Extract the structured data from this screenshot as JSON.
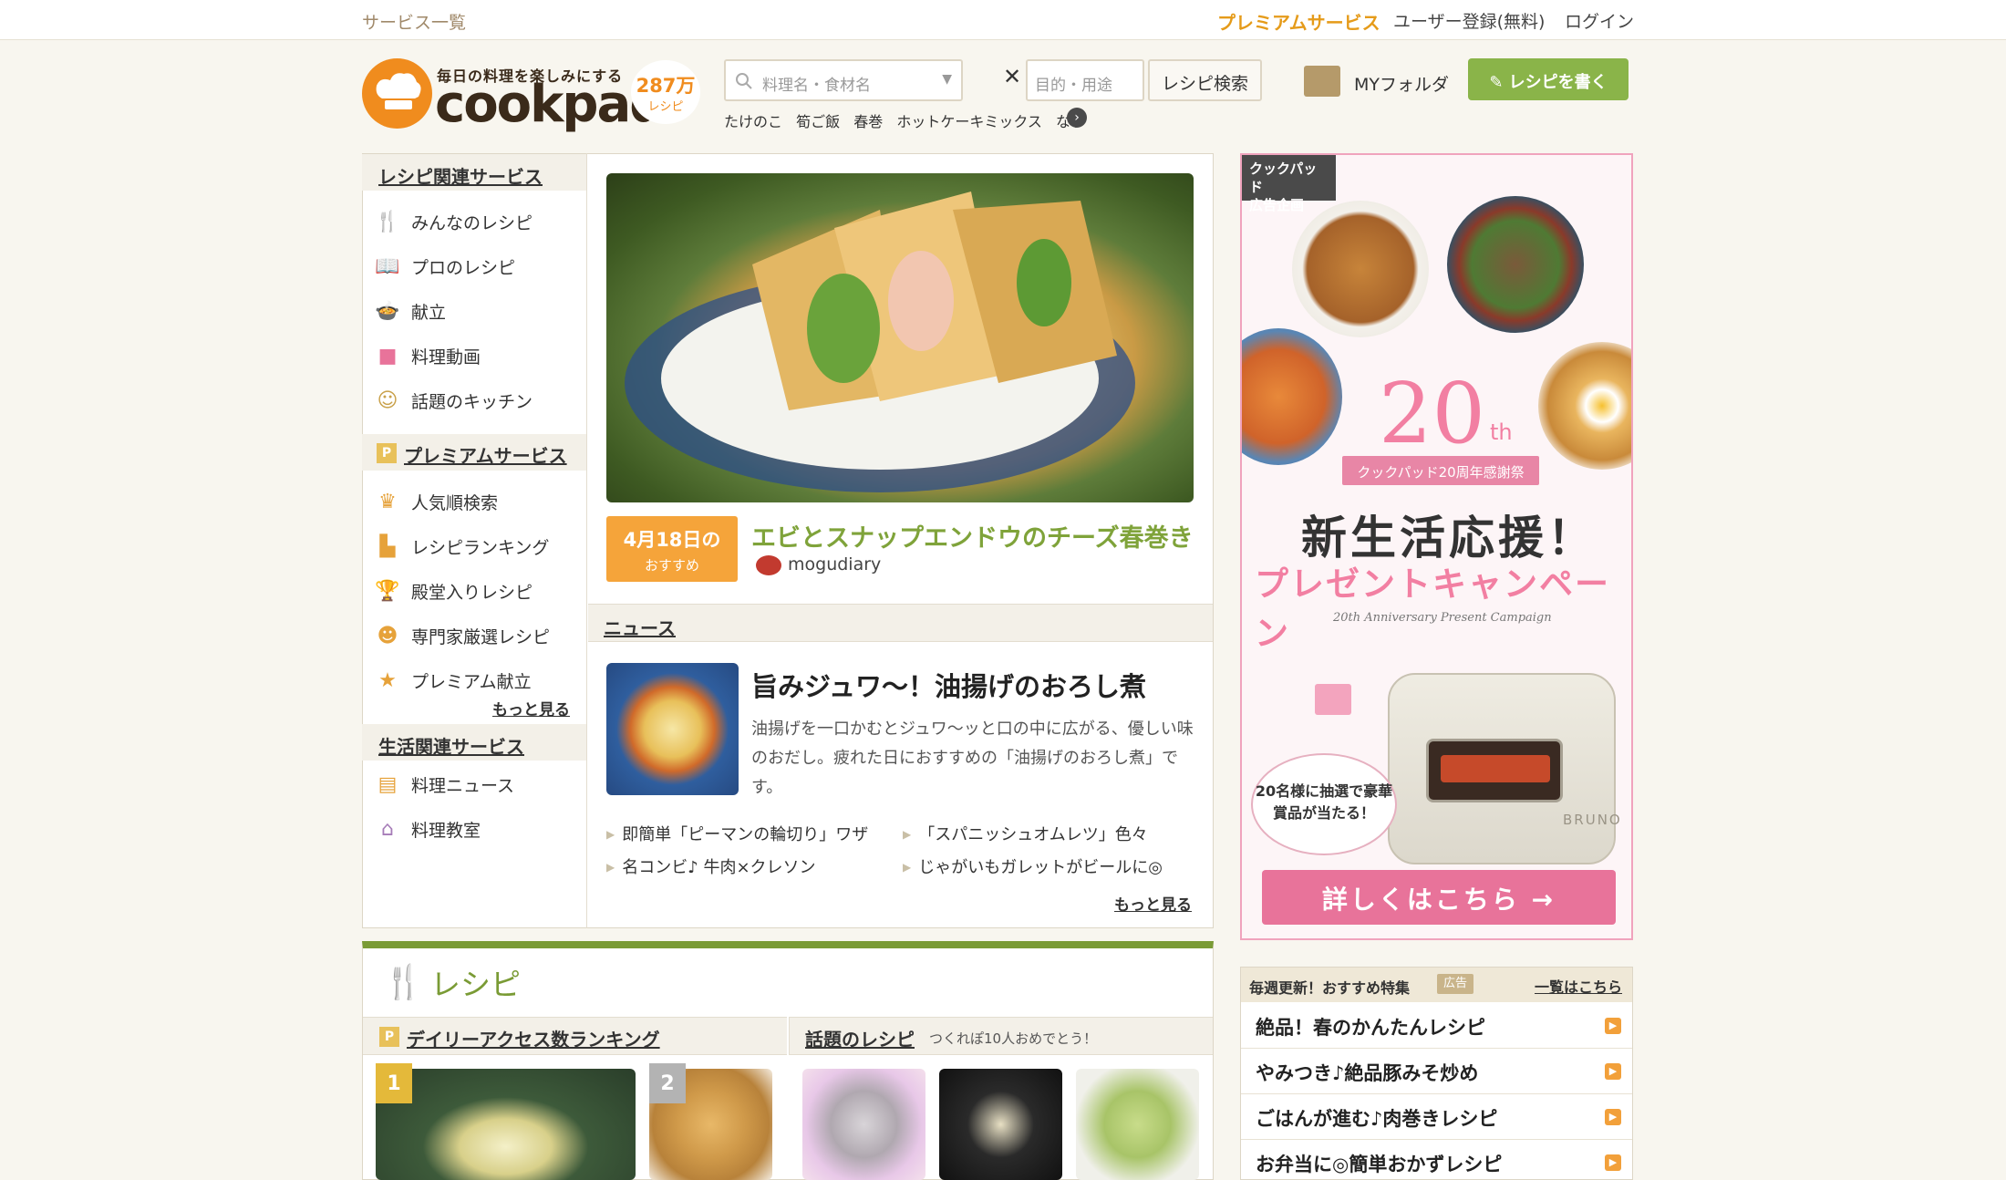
{
  "topbar": {
    "services": "サービス一覧",
    "premium": "プレミアムサービス",
    "register": "ユーザー登録(無料)",
    "login": "ログイン"
  },
  "header": {
    "tagline": "毎日の料理を楽しみにする",
    "brand": "cookpad",
    "count_number": "287万",
    "count_unit": "レシピ",
    "search_placeholder": "料理名・食材名",
    "purpose_placeholder": "目的・用途",
    "search_button": "レシピ検索",
    "keywords": [
      "たけのこ",
      "筍ご飯",
      "春巻",
      "ホットケーキミックス",
      "なす"
    ],
    "my_folder": "MYフォルダ",
    "write_recipe": "レシピを書く"
  },
  "leftnav": {
    "section1": "レシピ関連サービス",
    "items1": [
      "みんなのレシピ",
      "プロのレシピ",
      "献立",
      "料理動画",
      "話題のキッチン"
    ],
    "section2": "プレミアムサービス",
    "items2": [
      "人気順検索",
      "レシピランキング",
      "殿堂入りレシピ",
      "専門家厳選レシピ",
      "プレミアム献立"
    ],
    "more": "もっと見る",
    "section3": "生活関連サービス",
    "items3": [
      "料理ニュース",
      "料理教室"
    ]
  },
  "feature": {
    "date": "4月18日の",
    "date_sub": "おすすめ",
    "title": "エビとスナップエンドウのチーズ春巻き",
    "author": "mogudiary"
  },
  "news": {
    "heading": "ニュース",
    "title": "旨みジュワ〜！油揚げのおろし煮",
    "body": "油揚げを一口かむとジュワ〜ッと口の中に広がる、優しい味のおだし。疲れた日におすすめの「油揚げのおろし煮」です。",
    "links": [
      "即簡単「ピーマンの輪切り」ワザ",
      "「スパニッシュオムレツ」色々",
      "名コンビ♪ 牛肉×クレソン",
      "じゃがいもガレットがビールに◎"
    ],
    "more": "もっと見る"
  },
  "ad": {
    "tag_line1": "クックパッド",
    "tag_line2": "広告企画",
    "number": "20",
    "suffix": "th",
    "ribbon": "クックパッド20周年感謝祭",
    "headline": "新生活応援！",
    "headline2": "プレゼントキャンペーン",
    "subtitle": "20th Anniversary Present Campaign",
    "bubble": "20名様に抽選で豪華賞品が当たる！",
    "cta": "詳しくはこちら",
    "appliance": "BRUNO"
  },
  "recipes": {
    "title": "レシピ",
    "ranking_heading": "デイリーアクセス数ランキング",
    "hot_heading": "話題のレシピ",
    "hot_sub": "つくれぽ10人おめでとう！",
    "ranks": [
      "1",
      "2"
    ]
  },
  "features": {
    "heading": "毎週更新！おすすめ特集",
    "ad_label": "広告",
    "view_all": "一覧はこちら",
    "items": [
      "絶品！春のかんたんレシピ",
      "やみつき♪絶品豚みそ炒め",
      "ごはんが進む♪肉巻きレシピ",
      "お弁当に◎簡単おかずレシピ"
    ]
  },
  "colors": {
    "brand_orange": "#f08c1e",
    "accent_green": "#7a9b35",
    "premium_orange": "#e59b1a",
    "ad_pink": "#e8739a"
  }
}
